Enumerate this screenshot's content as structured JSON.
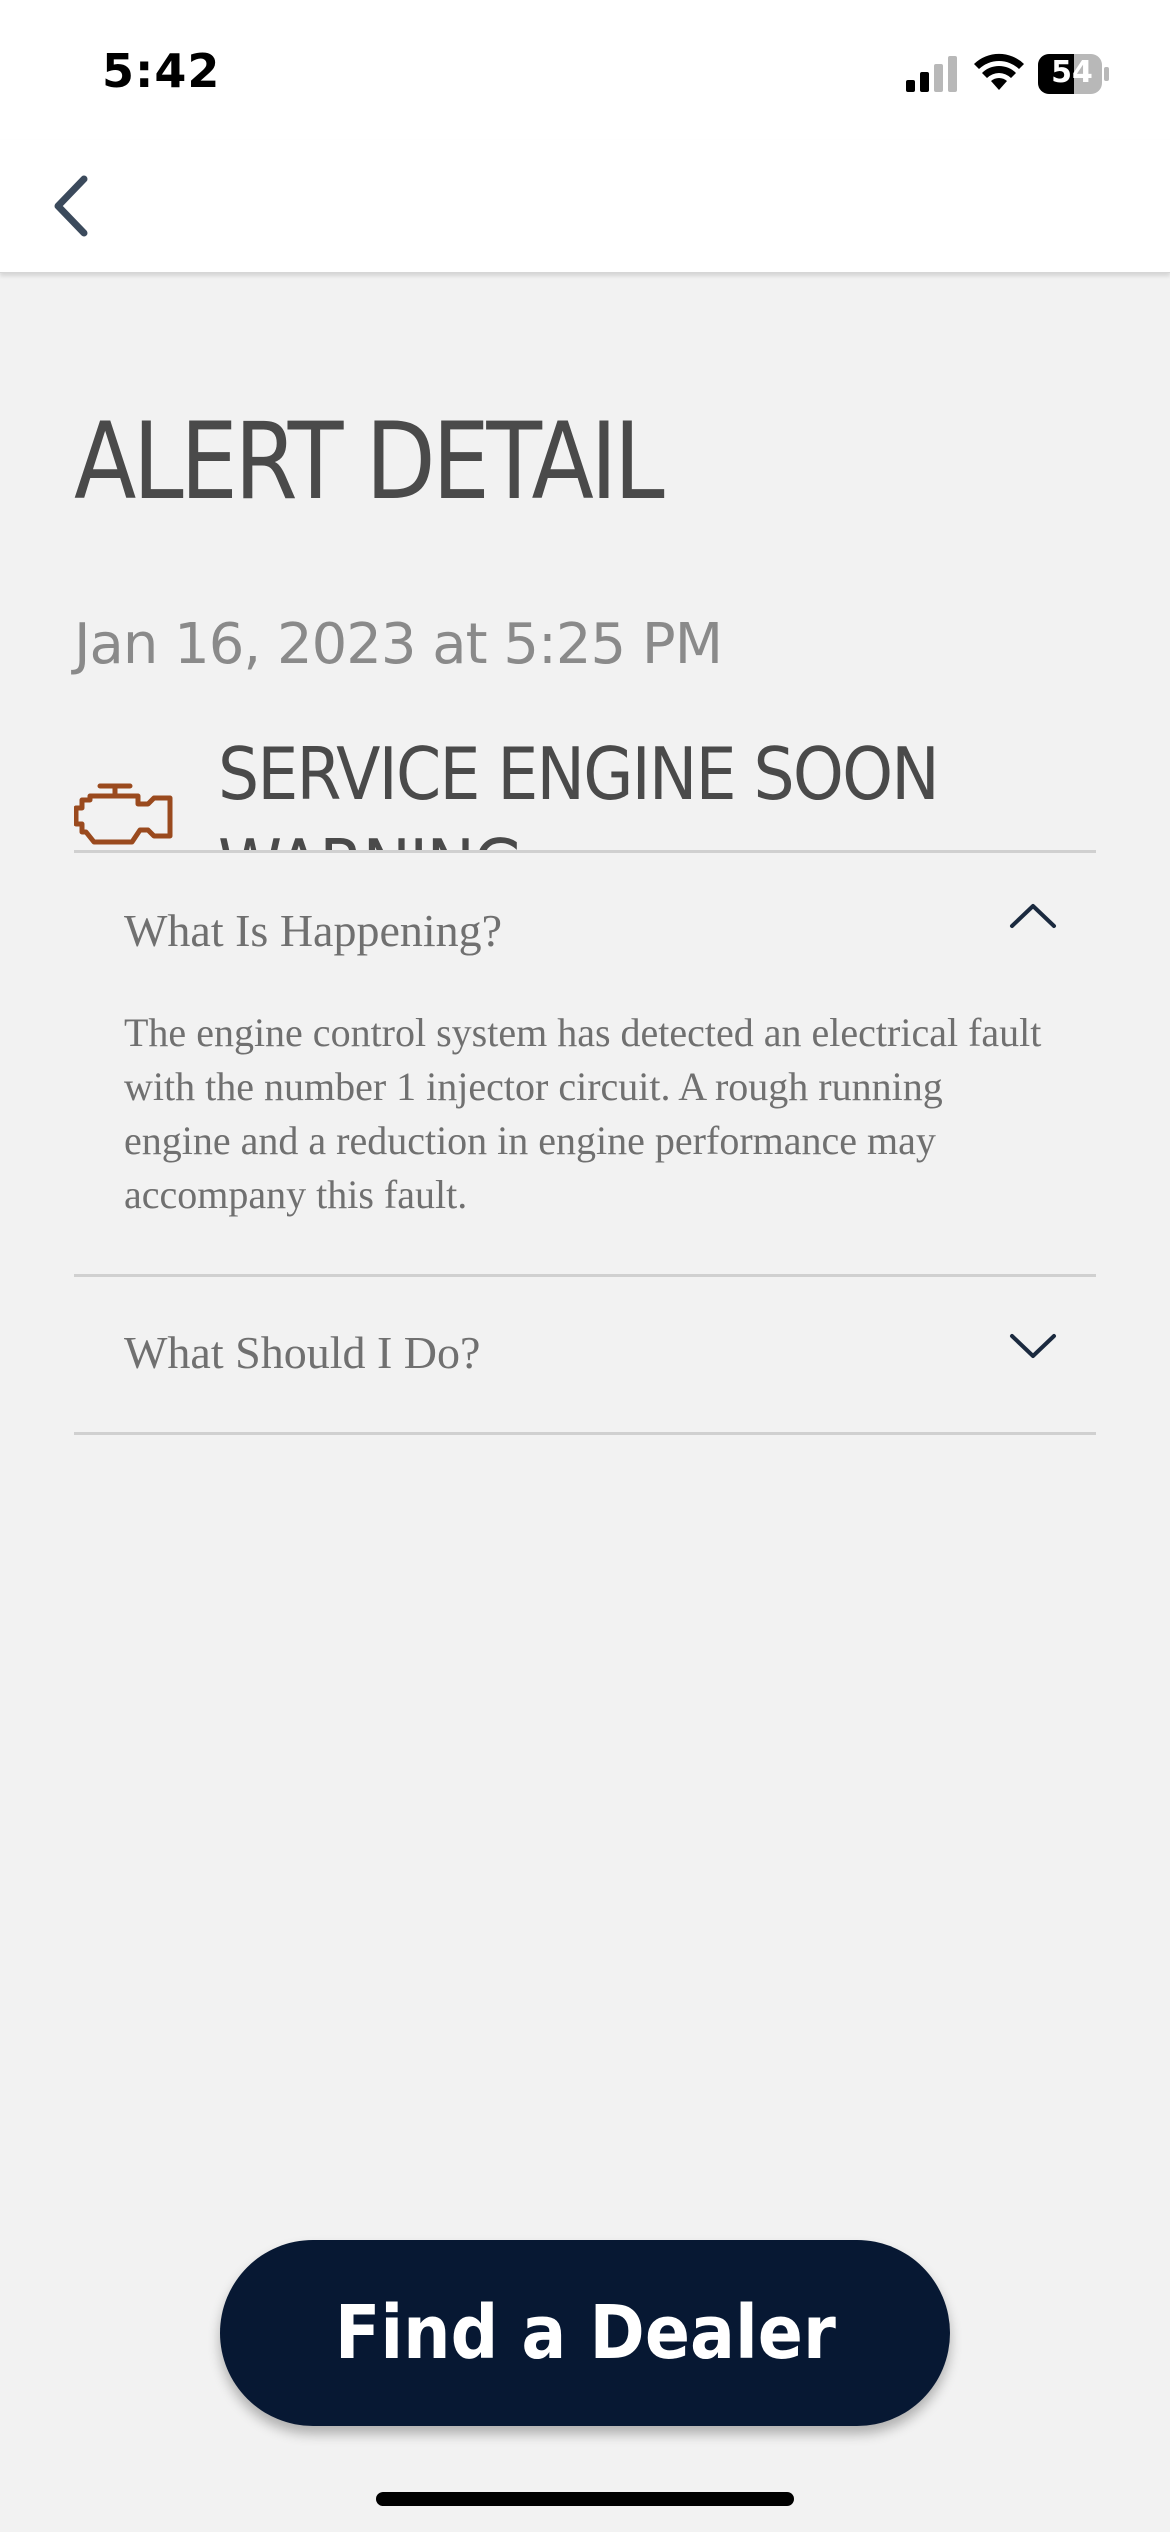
{
  "status_bar": {
    "time": "5:42",
    "battery": "54",
    "icons": [
      "cellular-signal-icon",
      "wifi-icon",
      "battery-icon"
    ]
  },
  "nav": {
    "back_icon": "chevron-left-icon"
  },
  "page": {
    "title": "ALERT DETAIL",
    "date": "Jan 16, 2023 at 5:25 PM"
  },
  "alert": {
    "icon": "check-engine-icon",
    "icon_color": "#9a4a1e",
    "name": "SERVICE ENGINE SOON WARNING"
  },
  "sections": [
    {
      "title": "What Is Happening?",
      "expanded": true,
      "chevron": "chevron-up-icon",
      "body": "The engine control system has detected an electrical fault with the number 1 injector circuit. A rough running engine and a reduction in engine performance may accompany this fault."
    },
    {
      "title": "What Should I Do?",
      "expanded": false,
      "chevron": "chevron-down-icon"
    }
  ],
  "actions": {
    "find_dealer_label": "Find a Dealer"
  },
  "colors": {
    "background": "#f2f2f2",
    "button": "#071833",
    "accent_icon": "#9a4a1e",
    "chevron": "#1b2a3f"
  }
}
